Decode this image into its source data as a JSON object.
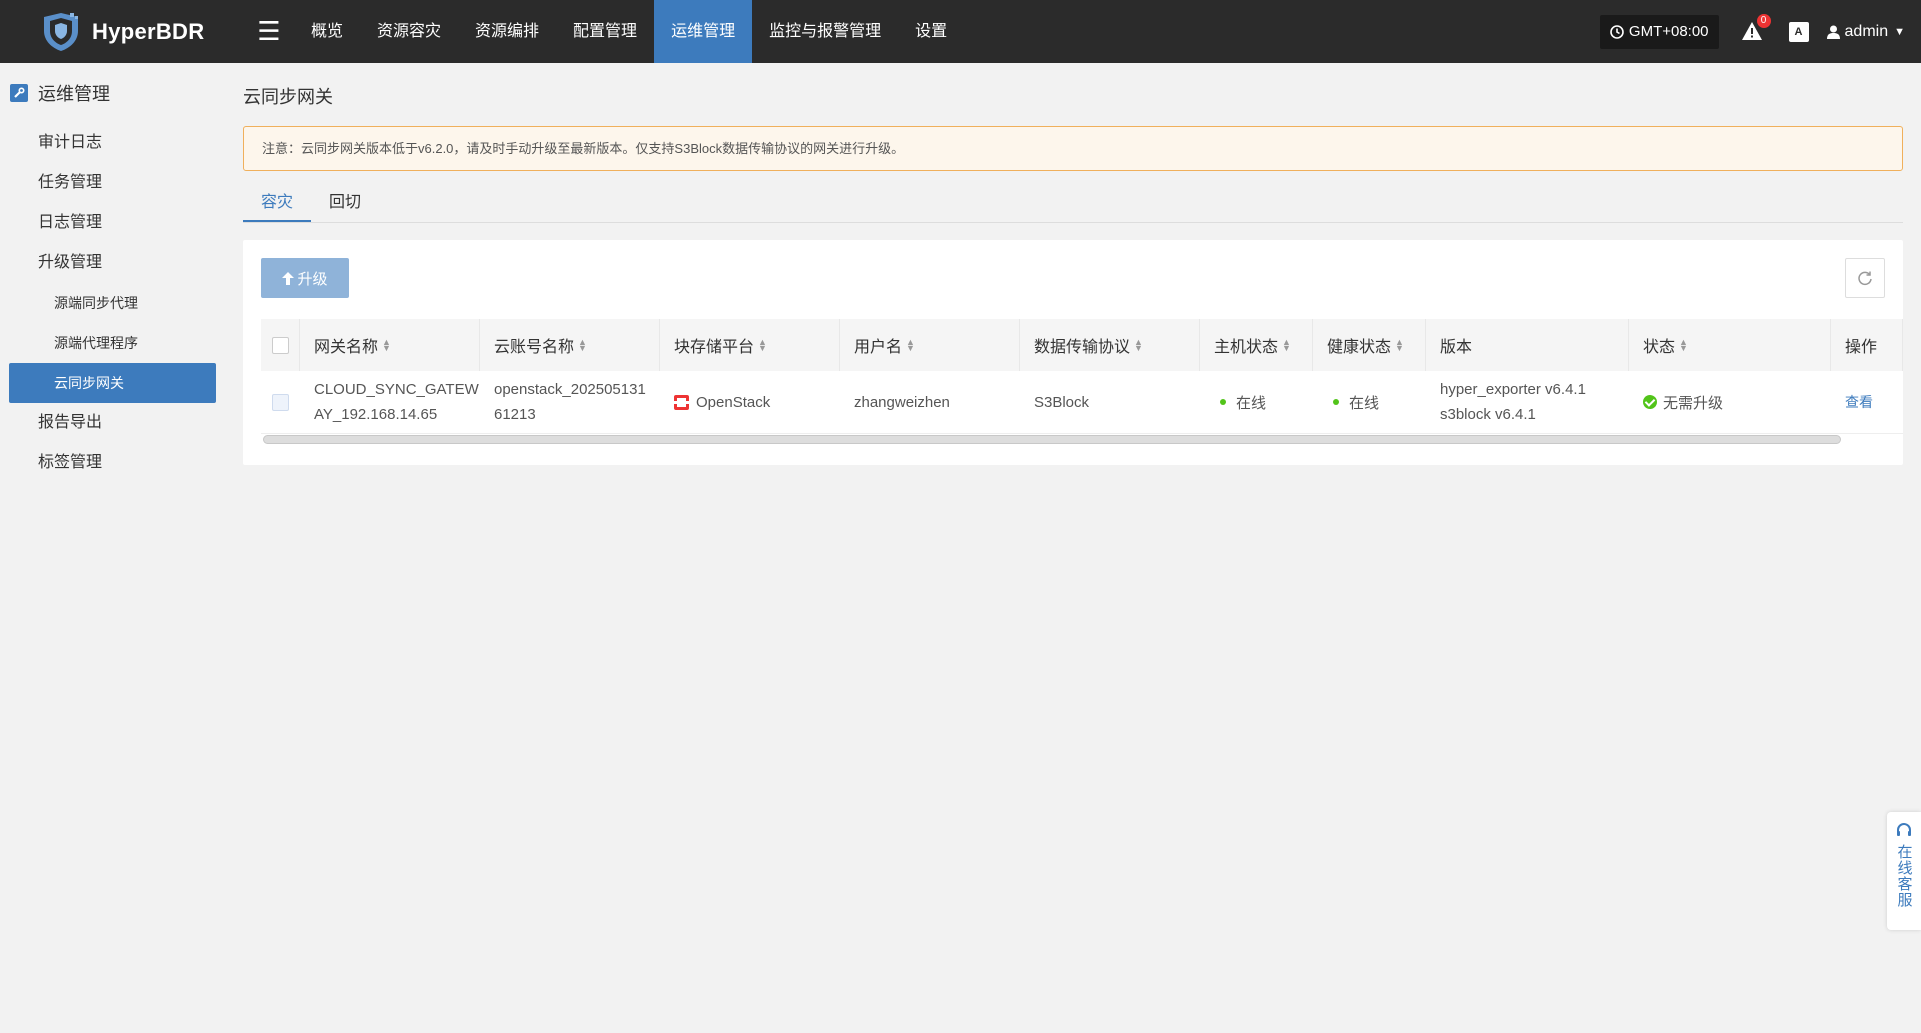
{
  "app": {
    "brand": "HyperBDR"
  },
  "nav": {
    "items": [
      "概览",
      "资源容灾",
      "资源编排",
      "配置管理",
      "运维管理",
      "监控与报警管理",
      "设置"
    ],
    "active_index": 4
  },
  "topright": {
    "timezone": "GMT+08:00",
    "alert_count": "0",
    "lang_label": "A",
    "user": "admin"
  },
  "sidebar": {
    "title": "运维管理",
    "items": [
      {
        "label": "审计日志"
      },
      {
        "label": "任务管理"
      },
      {
        "label": "日志管理"
      },
      {
        "label": "升级管理"
      },
      {
        "label": "源端同步代理"
      },
      {
        "label": "源端代理程序"
      },
      {
        "label": "云同步网关"
      },
      {
        "label": "报告导出"
      },
      {
        "label": "标签管理"
      }
    ]
  },
  "main": {
    "title": "云同步网关",
    "notice": "注意：云同步网关版本低于v6.2.0，请及时手动升级至最新版本。仅支持S3Block数据传输协议的网关进行升级。",
    "tabs": [
      "容灾",
      "回切"
    ],
    "upgrade_label": "升级"
  },
  "table": {
    "headers": [
      "网关名称",
      "云账号名称",
      "块存储平台",
      "用户名",
      "数据传输协议",
      "主机状态",
      "健康状态",
      "版本",
      "状态",
      "操作"
    ],
    "rows": [
      {
        "name_line1": "CLOUD_SYNC_GATEW",
        "name_line2": "AY_192.168.14.65",
        "account_line1": "openstack_202505131",
        "account_line2": "61213",
        "platform": "OpenStack",
        "username": "zhangweizhen",
        "protocol": "S3Block",
        "host_status": "在线",
        "health_status": "在线",
        "version_line1": "hyper_exporter v6.4.1",
        "version_line2": "s3block v6.4.1",
        "status": "无需升级",
        "action": "查看"
      }
    ]
  },
  "support": {
    "label": "在线客服"
  },
  "colors": {
    "accent": "#3d7bbd",
    "topbar": "#2b2b2b",
    "online": "#52c41a",
    "notice_border": "#f0b05c"
  }
}
